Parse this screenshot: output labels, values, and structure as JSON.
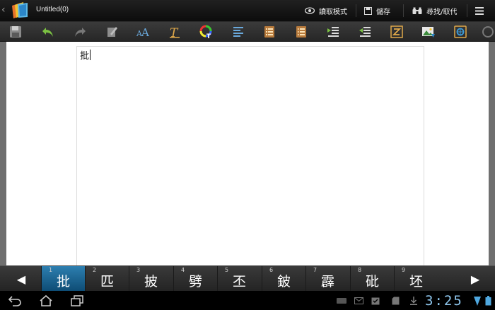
{
  "action_bar": {
    "title": "Untitled(0)",
    "read_mode_label": "讀取模式",
    "save_label": "儲存",
    "find_replace_label": "尋找/取代"
  },
  "toolbar": {
    "buttons": [
      {
        "icon": "save-icon"
      },
      {
        "icon": "undo-icon"
      },
      {
        "icon": "redo-icon"
      },
      {
        "icon": "clear-format-icon"
      },
      {
        "icon": "font-size-icon"
      },
      {
        "icon": "font-style-icon"
      },
      {
        "icon": "text-color-icon"
      },
      {
        "icon": "align-icon"
      },
      {
        "icon": "bullet-list-icon"
      },
      {
        "icon": "numbered-list-icon"
      },
      {
        "icon": "indent-increase-icon"
      },
      {
        "icon": "indent-decrease-icon"
      },
      {
        "icon": "text-direction-icon"
      },
      {
        "icon": "insert-image-icon"
      },
      {
        "icon": "insert-link-icon"
      },
      {
        "icon": "more-icon"
      }
    ]
  },
  "document": {
    "text": "批"
  },
  "candidates": {
    "prev_label": "◀",
    "next_label": "▶",
    "selected_index": 0,
    "items": [
      {
        "num": "1",
        "char": "批"
      },
      {
        "num": "2",
        "char": "匹"
      },
      {
        "num": "3",
        "char": "披"
      },
      {
        "num": "4",
        "char": "劈"
      },
      {
        "num": "5",
        "char": "丕"
      },
      {
        "num": "6",
        "char": "鈹"
      },
      {
        "num": "7",
        "char": "霹"
      },
      {
        "num": "8",
        "char": "砒"
      },
      {
        "num": "9",
        "char": "坯"
      }
    ]
  },
  "system_bar": {
    "clock": "3:25"
  },
  "colors": {
    "accent_blue": "#1f6fa0",
    "clock": "#8fc7ee",
    "toolbar_bg": "#2f2f2f"
  }
}
